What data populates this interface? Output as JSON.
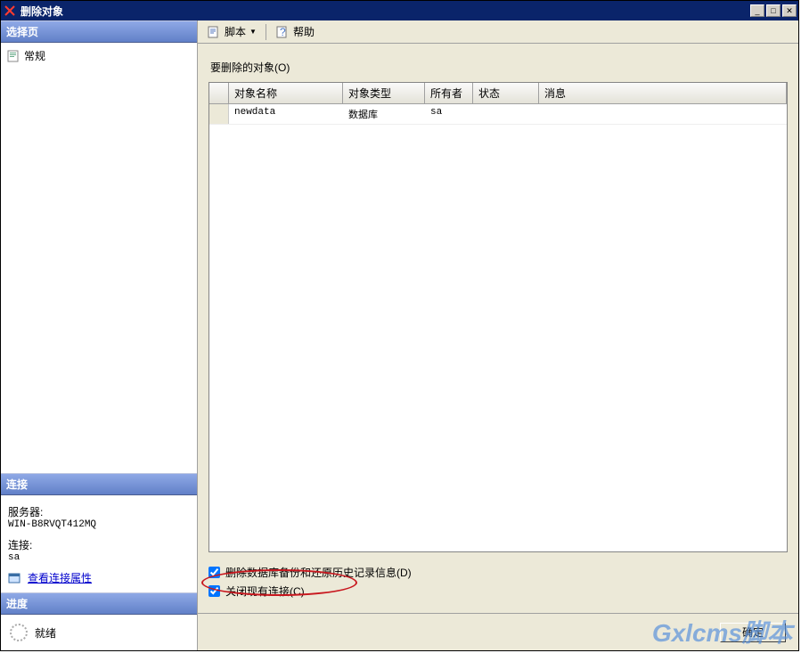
{
  "window": {
    "title": "删除对象"
  },
  "sidebar": {
    "select_header": "选择页",
    "tree": [
      {
        "label": "常规"
      }
    ],
    "connection_header": "连接",
    "server_label": "服务器:",
    "server_value": "WIN-B8RVQT412MQ",
    "conn_label": "连接:",
    "conn_value": "sa",
    "link_label": "查看连接属性",
    "progress_header": "进度",
    "progress_status": "就绪"
  },
  "toolbar": {
    "script_label": "脚本",
    "help_label": "帮助"
  },
  "main": {
    "objects_label": "要删除的对象(O)",
    "columns": {
      "name": "对象名称",
      "type": "对象类型",
      "owner": "所有者",
      "status": "状态",
      "message": "消息"
    },
    "rows": [
      {
        "name": "newdata",
        "type": "数据库",
        "owner": "sa",
        "status": "",
        "message": ""
      }
    ],
    "check1": "删除数据库备份和还原历史记录信息(D)",
    "check2": "关闭现有连接(C)"
  },
  "footer": {
    "ok": "确定"
  },
  "watermark": "Gxlcms脚本"
}
